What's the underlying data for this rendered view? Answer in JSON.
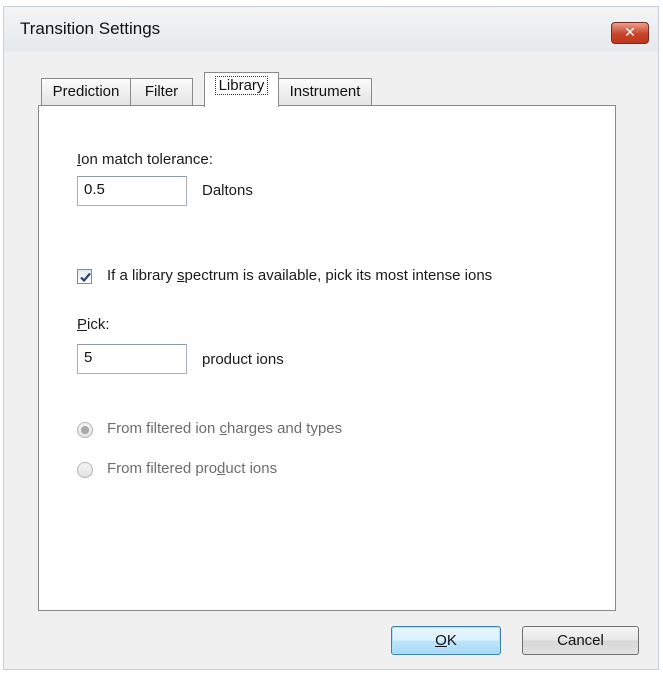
{
  "window": {
    "title": "Transition Settings",
    "close_glyph": "✕"
  },
  "tabs": [
    {
      "label": "Prediction",
      "active": false
    },
    {
      "label": "Filter",
      "active": false
    },
    {
      "label": "Library",
      "active": true
    },
    {
      "label": "Instrument",
      "active": false
    }
  ],
  "library": {
    "ion_match_tolerance": {
      "label_mnemonic": "I",
      "label_rest": "on match tolerance:",
      "value": "0.5",
      "unit": "Daltons"
    },
    "pick_most_intense": {
      "checked": true,
      "label_before": "If a library ",
      "label_mnemonic": "s",
      "label_after": "pectrum is available, pick its most intense ions"
    },
    "pick": {
      "label_mnemonic": "P",
      "label_rest": "ick:",
      "value": "5",
      "unit": "product ions"
    },
    "radio_filtered_charges": {
      "selected": true,
      "enabled": false,
      "label_before": "From filtered ion ",
      "label_mnemonic": "c",
      "label_after": "harges and types"
    },
    "radio_filtered_products": {
      "selected": false,
      "enabled": false,
      "label_before": "From filtered pro",
      "label_mnemonic": "d",
      "label_after": "uct ions"
    }
  },
  "buttons": {
    "ok": {
      "mnemonic": "O",
      "rest": "K"
    },
    "cancel": "Cancel"
  }
}
